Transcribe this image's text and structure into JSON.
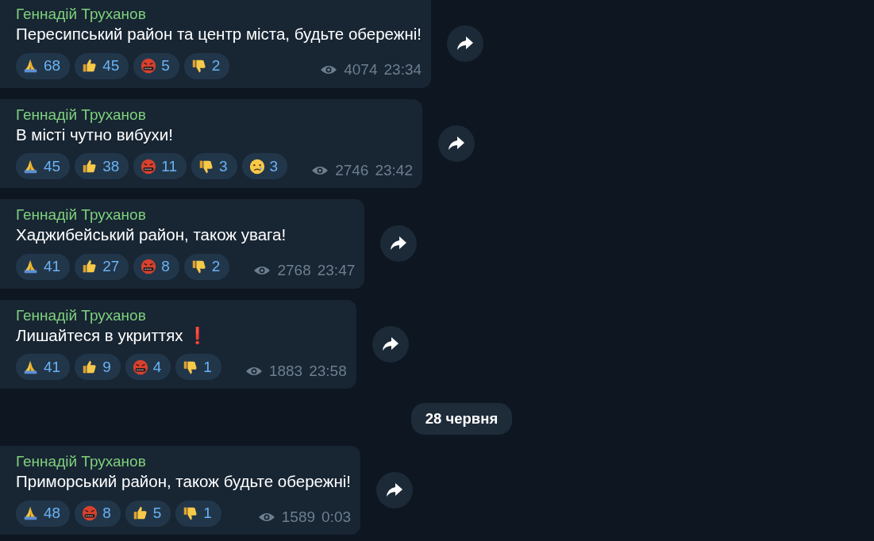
{
  "messages": [
    {
      "author": "Геннадій Труханов",
      "text": "Пересипський район та центр міста, будьте обережні!",
      "reactions": [
        {
          "kind": "pray",
          "count": "68"
        },
        {
          "kind": "thumbs_up",
          "count": "45"
        },
        {
          "kind": "angry",
          "count": "5"
        },
        {
          "kind": "thumbs_down",
          "count": "2"
        }
      ],
      "views": "4074",
      "time": "23:34"
    },
    {
      "author": "Геннадій Труханов",
      "text": "В місті чутно вибухи!",
      "reactions": [
        {
          "kind": "pray",
          "count": "45"
        },
        {
          "kind": "thumbs_up",
          "count": "38"
        },
        {
          "kind": "angry",
          "count": "11"
        },
        {
          "kind": "thumbs_down",
          "count": "3"
        },
        {
          "kind": "cry",
          "count": "3"
        }
      ],
      "views": "2746",
      "time": "23:42"
    },
    {
      "author": "Геннадій Труханов",
      "text": "Хаджибейський район, також увага!",
      "reactions": [
        {
          "kind": "pray",
          "count": "41"
        },
        {
          "kind": "thumbs_up",
          "count": "27"
        },
        {
          "kind": "angry",
          "count": "8"
        },
        {
          "kind": "thumbs_down",
          "count": "2"
        }
      ],
      "views": "2768",
      "time": "23:47"
    },
    {
      "author": "Геннадій Труханов",
      "text": "Лишайтеся в укриттях ❗",
      "reactions": [
        {
          "kind": "pray",
          "count": "41"
        },
        {
          "kind": "thumbs_up",
          "count": "9"
        },
        {
          "kind": "angry",
          "count": "4"
        },
        {
          "kind": "thumbs_down",
          "count": "1"
        }
      ],
      "views": "1883",
      "time": "23:58"
    },
    {
      "kind": "date",
      "text": "28 червня"
    },
    {
      "author": "Геннадій Труханов",
      "text": "Приморський район, також будьте обережні!",
      "reactions": [
        {
          "kind": "pray",
          "count": "48"
        },
        {
          "kind": "angry",
          "count": "8"
        },
        {
          "kind": "thumbs_up",
          "count": "5"
        },
        {
          "kind": "thumbs_down",
          "count": "1"
        }
      ],
      "views": "1589",
      "time": "0:03"
    }
  ]
}
